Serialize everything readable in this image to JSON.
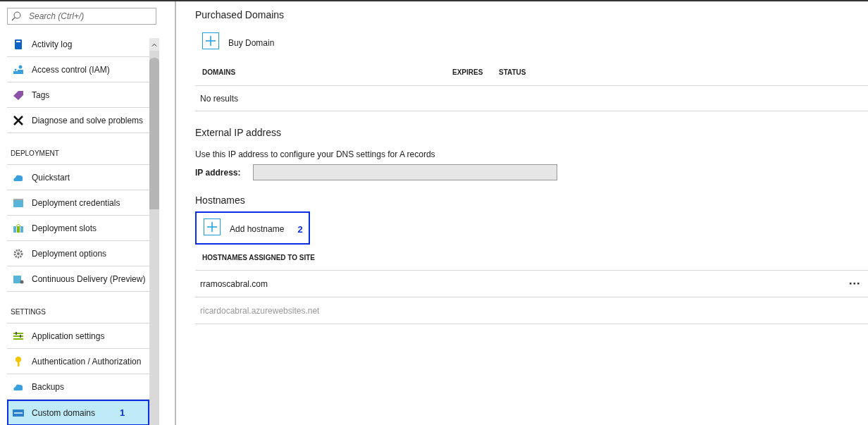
{
  "sidebar": {
    "search": {
      "placeholder": "Search (Ctrl+/)"
    },
    "items": [
      {
        "kind": "item",
        "label": "Activity log",
        "selected": false
      },
      {
        "kind": "item",
        "label": "Access control (IAM)",
        "selected": false
      },
      {
        "kind": "item",
        "label": "Tags",
        "selected": false
      },
      {
        "kind": "item",
        "label": "Diagnose and solve problems",
        "selected": false
      },
      {
        "kind": "section",
        "label": "DEPLOYMENT"
      },
      {
        "kind": "item",
        "label": "Quickstart",
        "selected": false
      },
      {
        "kind": "item",
        "label": "Deployment credentials",
        "selected": false
      },
      {
        "kind": "item",
        "label": "Deployment slots",
        "selected": false
      },
      {
        "kind": "item",
        "label": "Deployment options",
        "selected": false
      },
      {
        "kind": "item",
        "label": "Continuous Delivery (Preview)",
        "selected": false
      },
      {
        "kind": "section",
        "label": "SETTINGS"
      },
      {
        "kind": "item",
        "label": "Application settings",
        "selected": false
      },
      {
        "kind": "item",
        "label": "Authentication / Authorization",
        "selected": false
      },
      {
        "kind": "item",
        "label": "Backups",
        "selected": false
      },
      {
        "kind": "item",
        "label": "Custom domains",
        "selected": true,
        "annotation": "1"
      }
    ]
  },
  "purchased_domains": {
    "title": "Purchased Domains",
    "button": "Buy Domain",
    "table": {
      "columns": [
        "DOMAINS",
        "EXPIRES",
        "STATUS"
      ],
      "empty": "No results"
    }
  },
  "external_ip": {
    "title": "External IP address",
    "description": "Use this IP address to configure your DNS settings for A records",
    "label": "IP address:"
  },
  "hostnames": {
    "title": "Hostnames",
    "button": "Add hostname",
    "annotation": "2",
    "table": {
      "columns": [
        "HOSTNAMES ASSIGNED TO SITE"
      ],
      "rows": [
        {
          "name": "rramoscabral.com",
          "disabled": false,
          "menu": true
        },
        {
          "name": "ricardocabral.azurewebsites.net",
          "disabled": true,
          "menu": false
        }
      ]
    }
  }
}
